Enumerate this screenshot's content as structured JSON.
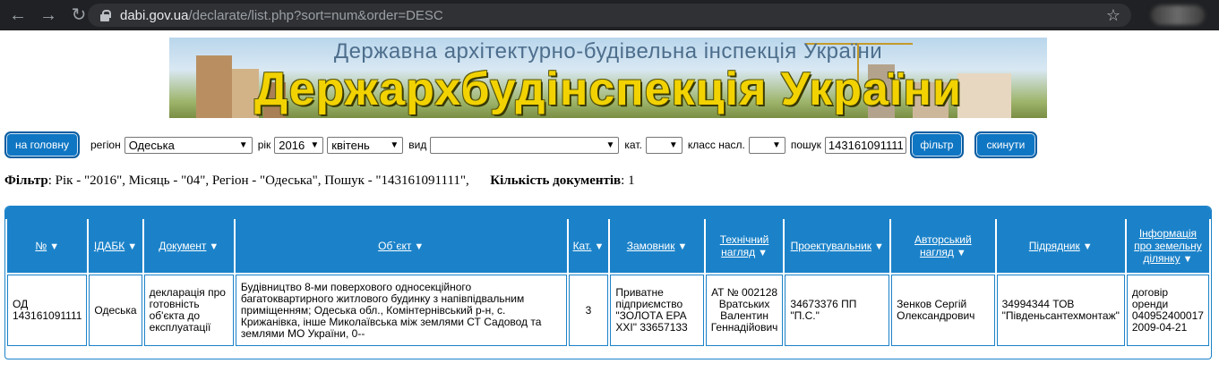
{
  "browser": {
    "url_host": "dabi.gov.ua",
    "url_path": "/declarate/list.php?sort=num&order=DESC"
  },
  "banner": {
    "subtitle": "Державна архітектурно-будівельна інспекція України",
    "title": "Держархбудінспекція України"
  },
  "filters": {
    "home_button": "на головну",
    "region_label": "регіон",
    "region_value": "Одеська",
    "year_label": "рік",
    "year_value": "2016",
    "month_value": "квітень",
    "type_label": "вид",
    "type_value": "",
    "cat_label": "кат.",
    "cat_value": "",
    "class_label": "класс насл.",
    "class_value": "",
    "search_label": "пошук",
    "search_value": "143161091111",
    "filter_button": "фільтр",
    "reset_button": "скинути"
  },
  "summary": {
    "filter_label": "Фільтр",
    "filter_text": ": Рік - \"2016\", Місяць - \"04\", Регіон - \"Одеська\", Пошук - \"143161091111\",",
    "count_label": "Кількість документів",
    "count_value": ": 1"
  },
  "table": {
    "headers": [
      "№",
      "ІДАБК",
      "Документ",
      "Об`єкт",
      "Кат.",
      "Замовник",
      "Технічний нагляд",
      "Проектувальник",
      "Авторський нагляд",
      "Підрядник",
      "Інформація про земельну ділянку"
    ],
    "rows": [
      {
        "num": "ОД 143161091111",
        "idabk": "Одеська",
        "doc": "декларація про готовність об'єкта до експлуатації",
        "object": "Будівництво 8-ми поверхового односекційного багатоквартирного житлового будинку з напівпідвальним приміщенням; Одеська обл., Комінтернівський р-н, с. Крижанівка, інше Миколаївська між землями СТ Садовод та землями МО України, 0--",
        "cat": "3",
        "customer": "Приватне підприємство \"ЗОЛОТА ЕРА XXI\" 33657133",
        "tech": "АТ № 002128 Вратських Валентин Геннадійович",
        "designer": "34673376 ПП \"П.С.\"",
        "author": "Зенков Сергій Олександрович",
        "contractor": "34994344 ТОВ \"Південьсантехмонтаж\"",
        "land": "договір оренди 040952400017 2009-04-21"
      }
    ]
  }
}
